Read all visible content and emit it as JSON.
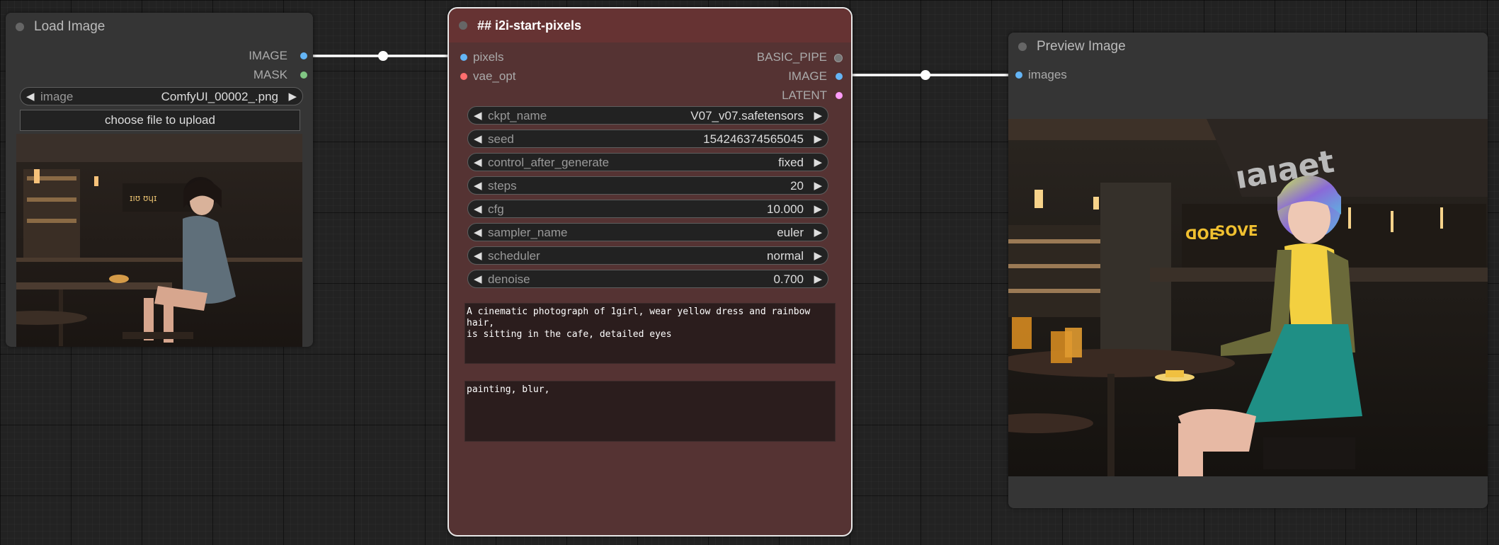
{
  "load_image": {
    "title": "Load Image",
    "outputs": [
      {
        "label": "IMAGE",
        "color": "#64b5f6"
      },
      {
        "label": "MASK",
        "color": "#81c784"
      }
    ],
    "image_widget": {
      "label": "image",
      "value": "ComfyUI_00002_.png"
    },
    "upload_button": "choose file to upload"
  },
  "i2i_node": {
    "title": "## i2i-start-pixels",
    "inputs": [
      {
        "label": "pixels",
        "color": "#64b5f6"
      },
      {
        "label": "vae_opt",
        "color": "#ff6e6e"
      }
    ],
    "outputs": [
      {
        "label": "BASIC_PIPE",
        "color": "#777777"
      },
      {
        "label": "IMAGE",
        "color": "#64b5f6"
      },
      {
        "label": "LATENT",
        "color": "#ff9cf9"
      }
    ],
    "widgets": [
      {
        "label": "ckpt_name",
        "value": "V07_v07.safetensors"
      },
      {
        "label": "seed",
        "value": "154246374565045"
      },
      {
        "label": "control_after_generate",
        "value": "fixed"
      },
      {
        "label": "steps",
        "value": "20"
      },
      {
        "label": "cfg",
        "value": "10.000"
      },
      {
        "label": "sampler_name",
        "value": "euler"
      },
      {
        "label": "scheduler",
        "value": "normal"
      },
      {
        "label": "denoise",
        "value": "0.700"
      }
    ],
    "positive_prompt": "A cinematic photograph of 1girl, wear yellow dress and rainbow hair,\nis sitting in the cafe, detailed eyes",
    "negative_prompt": "painting, blur,"
  },
  "preview_image": {
    "title": "Preview Image",
    "inputs": [
      {
        "label": "images",
        "color": "#64b5f6"
      }
    ],
    "image_sign_text": "ıaıaet"
  },
  "colors": {
    "canvas": "#222222",
    "node_bg": "#353535",
    "i2i_bg": "#553333",
    "i2i_title": "#663333",
    "wire": "#ffffff"
  }
}
